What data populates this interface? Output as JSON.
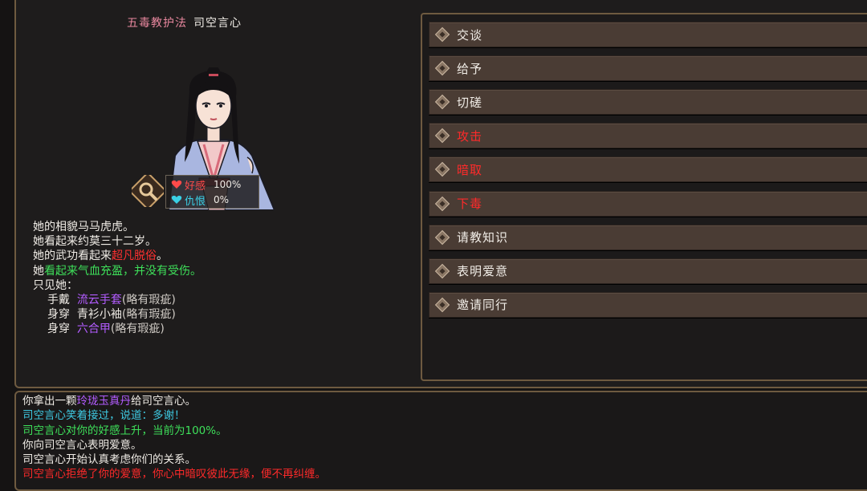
{
  "npc": {
    "sect_title": "五毒教护法",
    "name": "司空言心"
  },
  "relation": {
    "favor_label": "好感",
    "favor_value": "100%",
    "hatred_label": "仇恨",
    "hatred_value": "0%",
    "favor_color": "#ff4a4a",
    "hatred_color": "#3ad0e6"
  },
  "description": {
    "line1": "她的相貌马马虎虎。",
    "line2": "她看起来约莫三十二岁。",
    "line3_prefix": "她的武功看起来",
    "line3_highlight": "超凡脱俗",
    "line3_suffix": "。",
    "line4_prefix": "她",
    "line4_highlight": "看起来气血充盈，并没有受伤。",
    "line5": "只见她：",
    "equip": [
      {
        "verb": "手戴",
        "item": "流云手套",
        "quality": "(略有瑕疵)",
        "item_color": "purple"
      },
      {
        "verb": "身穿",
        "item": "青衫小袖",
        "quality": "(略有瑕疵)",
        "item_color": "white"
      },
      {
        "verb": "身穿",
        "item": "六合甲",
        "quality": "(略有瑕疵)",
        "item_color": "purple"
      }
    ]
  },
  "actions": [
    {
      "label": "交谈",
      "hostile": false
    },
    {
      "label": "给予",
      "hostile": false
    },
    {
      "label": "切磋",
      "hostile": false
    },
    {
      "label": "攻击",
      "hostile": true
    },
    {
      "label": "暗取",
      "hostile": true
    },
    {
      "label": "下毒",
      "hostile": true
    },
    {
      "label": "请教知识",
      "hostile": false
    },
    {
      "label": "表明爱意",
      "hostile": false
    },
    {
      "label": "邀请同行",
      "hostile": false
    }
  ],
  "log": {
    "line1_a": "你拿出一颗",
    "line1_item": "玲珑玉真丹",
    "line1_b": "给司空言心。",
    "line2": "司空言心笑着接过，说道：多谢！",
    "line3": "司空言心对你的好感上升，当前为100%。",
    "line4": "你向司空言心表明爱意。",
    "line5": "司空言心开始认真考虑你们的关系。",
    "line6": "司空言心拒绝了你的爱意，你心中暗叹彼此无缘，便不再纠缠。"
  }
}
